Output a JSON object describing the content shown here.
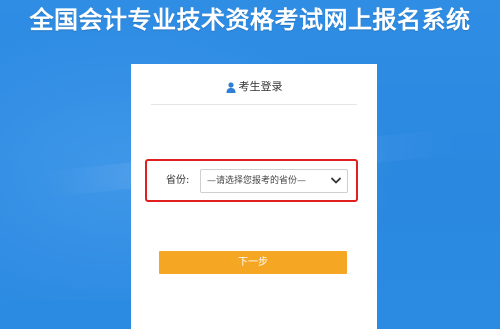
{
  "header": {
    "title": "全国会计专业技术资格考试网上报名系统"
  },
  "login_card": {
    "heading": "考生登录",
    "heading_icon": "user-icon",
    "province": {
      "label": "省份:",
      "selected_value": "—请选择您报考的省份—"
    },
    "next_button_label": "下一步"
  },
  "colors": {
    "background": "#2b8ae2",
    "card": "#ffffff",
    "button": "#f5a623",
    "highlight_border": "#e02020"
  }
}
